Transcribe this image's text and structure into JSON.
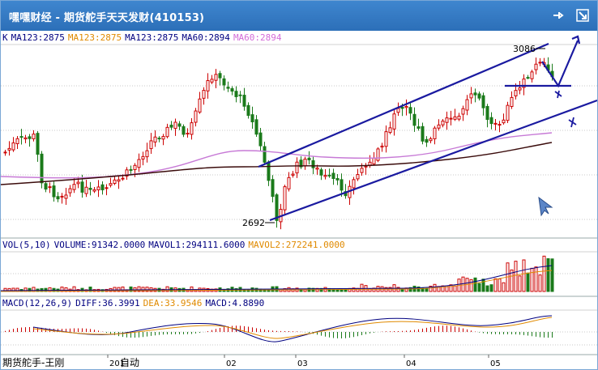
{
  "window": {
    "title": "嘿嘿财经 - 期货舵手天天发财(410153)"
  },
  "icons": {
    "pin": "pin-icon",
    "maximize": "maximize-icon"
  },
  "main_legend": {
    "prefix": "K",
    "items": [
      {
        "text": "MA123:2875",
        "color": "#000080"
      },
      {
        "text": "MA123:2875",
        "color": "#e08a00"
      },
      {
        "text": "MA123:2875",
        "color": "#000080"
      },
      {
        "text": "MA60:2894",
        "color": "#000080"
      },
      {
        "text": "MA60:2894",
        "color": "#d36bd8"
      }
    ]
  },
  "price_annotations": {
    "high": "3086",
    "low": "2692"
  },
  "volume_legend": {
    "items": [
      {
        "text": "VOL(5,10)",
        "color": "#000080"
      },
      {
        "text": "VOLUME:91342.0000",
        "color": "#000080"
      },
      {
        "text": "MAVOL1:294111.6000",
        "color": "#000080"
      },
      {
        "text": "MAVOL2:272241.0000",
        "color": "#e08a00"
      }
    ]
  },
  "macd_legend": {
    "items": [
      {
        "text": "MACD(12,26,9)",
        "color": "#000080"
      },
      {
        "text": "DIFF:36.3991",
        "color": "#000080"
      },
      {
        "text": "DEA:33.9546",
        "color": "#e08a00"
      },
      {
        "text": "MACD:4.8890",
        "color": "#000080"
      }
    ]
  },
  "x_axis": {
    "labels": [
      "201",
      "02",
      "03",
      "04",
      "05"
    ]
  },
  "watermark": "期货舵手-王刚",
  "watermark_suffix": "自动",
  "colors": {
    "up": "#cc0000",
    "down": "#1a7a1a",
    "channel": "#1a1aa0",
    "ma_purple": "#c77ad6",
    "ma_dark": "#3a0b0b",
    "titlebar": "#3378c2"
  }
}
